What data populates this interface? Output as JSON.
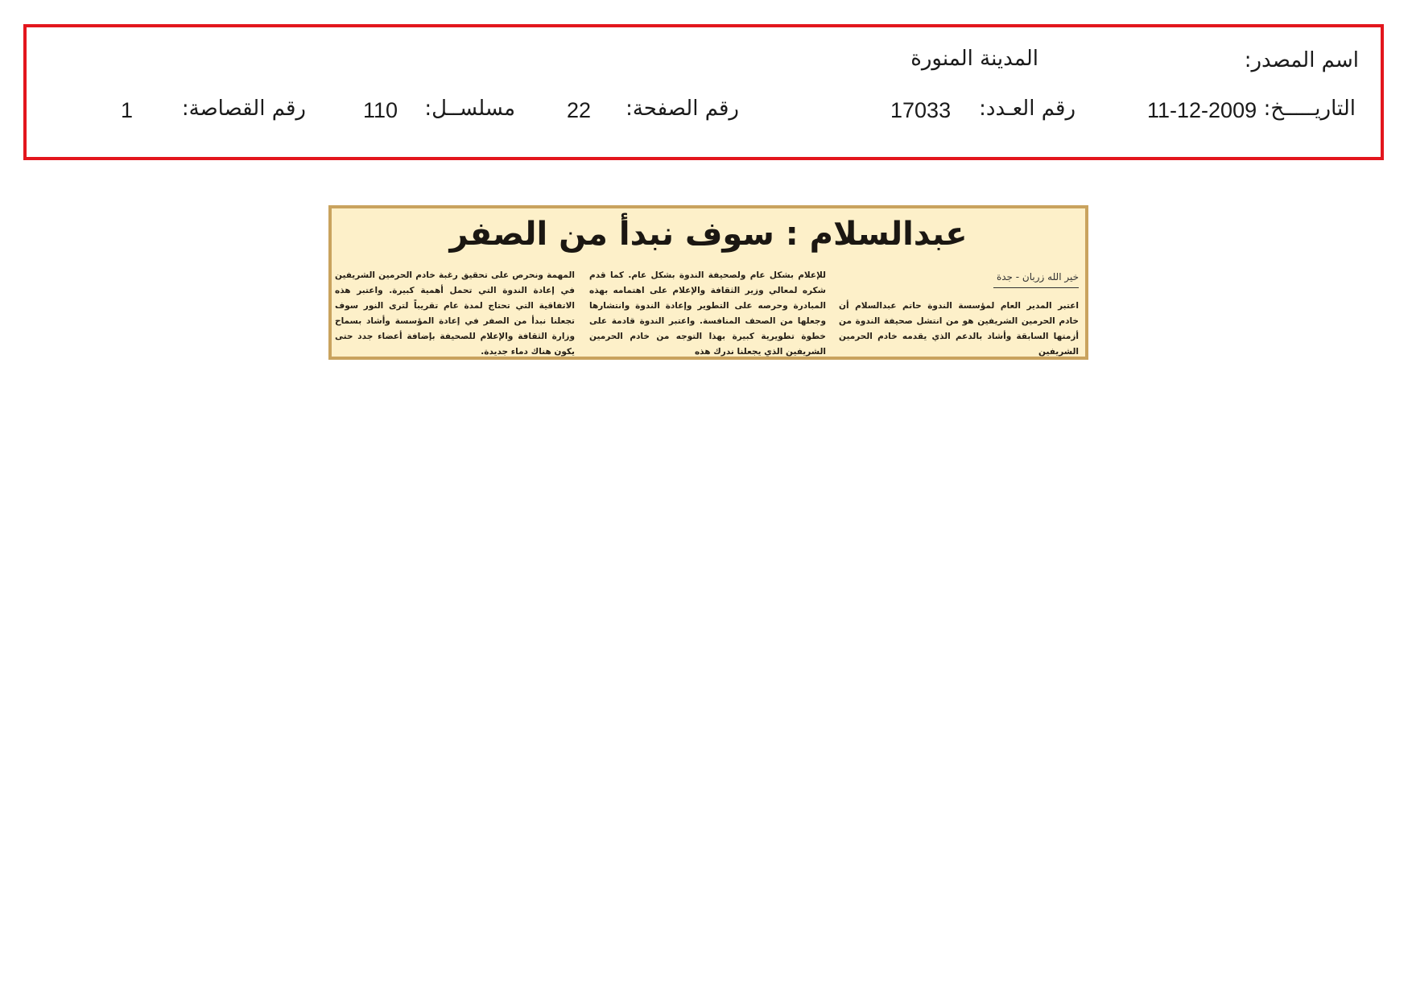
{
  "header": {
    "source_label": "اسم المصدر:",
    "source_value": "المدينة المنورة",
    "date_label": "التاريـــــخ:",
    "date_value": "11-12-2009",
    "issue_label": "رقم العـدد:",
    "issue_value": "17033",
    "page_label": "رقم الصفحة:",
    "page_value": "22",
    "serial_label": "مسلســل:",
    "serial_value": "110",
    "clip_label": "رقم القصاصة:",
    "clip_value": "1"
  },
  "article": {
    "headline": "عبدالسلام : سوف نبدأ من الصفر",
    "byline": "خير الله زربان - جدة",
    "columns": [
      "اعتبر المدير العام لمؤسسة الندوة حاتم عبدالسلام أن خادم الحرمين الشريفين هو من انتشل صحيفة الندوة من أزمتها السابقة وأشاد بالدعم الذي يقدمه خادم الحرمين الشريفين",
      "للإعلام بشكل عام ولصحيفة الندوة بشكل عام. كما قدم شكره لمعالي وزير الثقافة والإعلام على اهتمامه بهذه المبادرة وحرصه على التطوير وإعادة الندوة وانتشارها وجعلها من الصحف المنافسة. واعتبر الندوة قادمة على خطوة تطويرية كبيرة بهذا التوجه من خادم الحرمين الشريفين الذي يجعلنا ندرك هذه",
      "المهمة ونحرص على تحقيق رغبة خادم الحرمين الشريفين في إعادة الندوة التي تحمل أهمية كبيرة. واعتبر هذه الاتفاقية التي تحتاج لمدة عام تقريباً لترى النور سوف تجعلنا نبدأ من الصفر في إعادة المؤسسة وأشاد بسماح وزارة الثقافة والإعلام للصحيفة بإضافة أعضاء جدد حتى يكون هناك دماء جديدة."
    ]
  },
  "colors": {
    "header_border": "#e3161d",
    "clip_background": "#fdf0c9",
    "clip_border": "#c9a35e"
  }
}
